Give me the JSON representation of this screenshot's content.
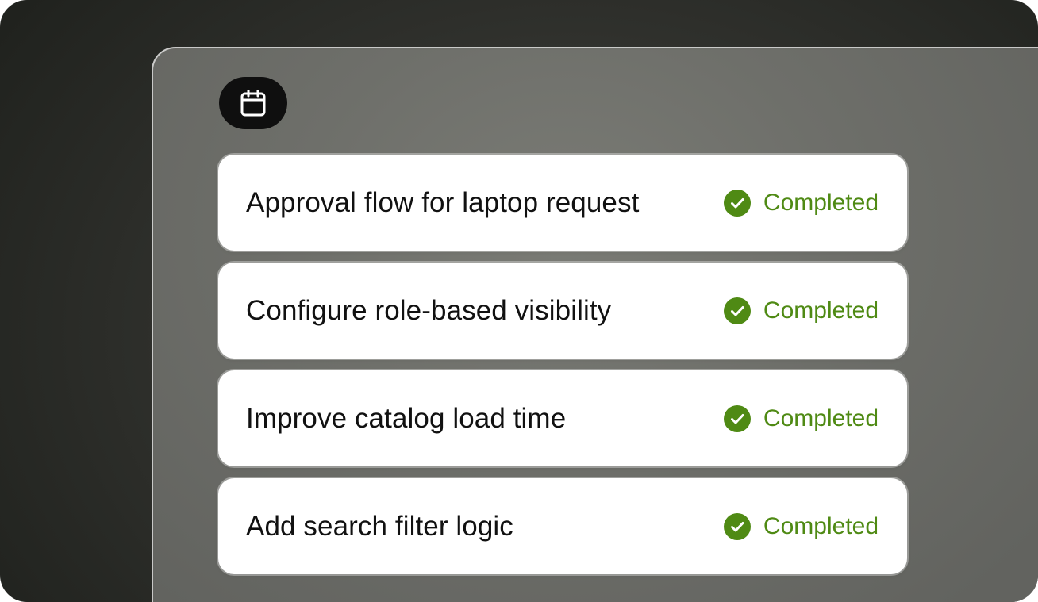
{
  "header": {
    "icon": "calendar-icon"
  },
  "tasks": [
    {
      "title": "Approval flow for laptop request",
      "status": "Completed",
      "status_icon": "check-circle-icon"
    },
    {
      "title": "Configure role-based visibility",
      "status": "Completed",
      "status_icon": "check-circle-icon"
    },
    {
      "title": "Improve catalog load time",
      "status": "Completed",
      "status_icon": "check-circle-icon"
    },
    {
      "title": "Add search filter logic",
      "status": "Completed",
      "status_icon": "check-circle-icon"
    }
  ],
  "colors": {
    "status_green": "#4f8a14",
    "badge_bg": "#0f0f0f"
  }
}
